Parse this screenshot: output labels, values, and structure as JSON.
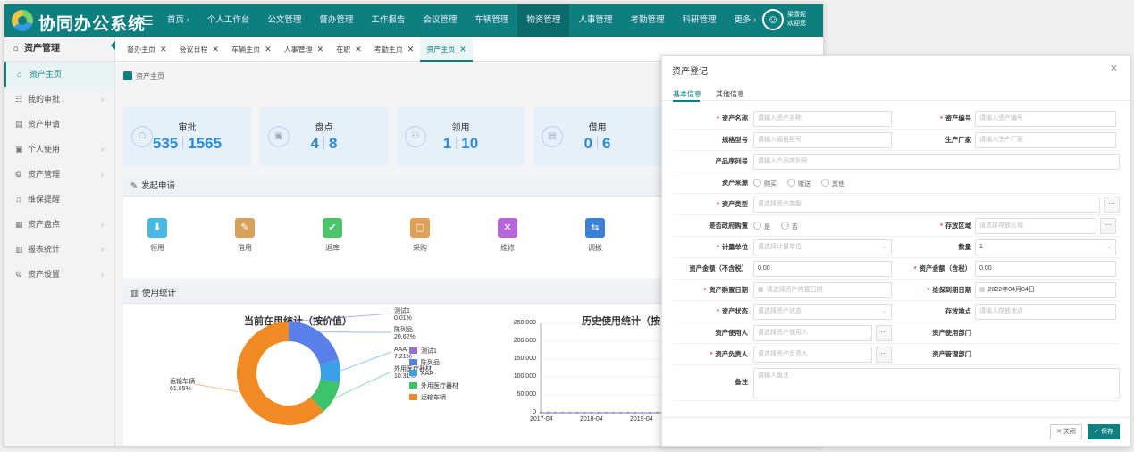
{
  "app": {
    "title": "协同办公系统",
    "user": {
      "name": "梁雪妮",
      "greeting": "欢迎您"
    }
  },
  "nav": {
    "items": [
      "首页 ›",
      "个人工作台",
      "公文管理",
      "督办管理",
      "工作报告",
      "会议管理",
      "车辆管理",
      "物资管理",
      "人事管理",
      "考勤管理",
      "科研管理",
      "更多 ›"
    ],
    "active_index": 7
  },
  "sidebar": {
    "header": "资产管理",
    "items": [
      {
        "label": "资产主页",
        "icon": "home-icon",
        "glyph": "⌂",
        "chevron": false,
        "active": true
      },
      {
        "label": "我的审批",
        "icon": "approval-icon",
        "glyph": "☷",
        "chevron": true
      },
      {
        "label": "资产申请",
        "icon": "apply-icon",
        "glyph": "▤",
        "chevron": false
      },
      {
        "label": "个人使用",
        "icon": "personal-icon",
        "glyph": "▣",
        "chevron": true
      },
      {
        "label": "资产管理",
        "icon": "manage-icon",
        "glyph": "❂",
        "chevron": true
      },
      {
        "label": "维保提醒",
        "icon": "bell-icon",
        "glyph": "♫",
        "chevron": false
      },
      {
        "label": "资产盘点",
        "icon": "inventory-icon",
        "glyph": "▦",
        "chevron": true
      },
      {
        "label": "报表统计",
        "icon": "report-icon",
        "glyph": "▥",
        "chevron": true
      },
      {
        "label": "资产设置",
        "icon": "settings-icon",
        "glyph": "⚙",
        "chevron": true
      }
    ]
  },
  "tabs": [
    {
      "label": "督办主页"
    },
    {
      "label": "会议日程"
    },
    {
      "label": "车辆主页"
    },
    {
      "label": "人事管理"
    },
    {
      "label": "在职"
    },
    {
      "label": "考勤主页"
    },
    {
      "label": "资产主页",
      "active": true
    }
  ],
  "breadcrumb": "资产主页",
  "stats": [
    {
      "label": "审批",
      "a": "535",
      "b": "1565",
      "icon": "approval-stat-icon",
      "glyph": "☖"
    },
    {
      "label": "盘点",
      "a": "4",
      "b": "8",
      "icon": "inventory-stat-icon",
      "glyph": "▣"
    },
    {
      "label": "领用",
      "a": "1",
      "b": "10",
      "icon": "receive-stat-icon",
      "glyph": "⚇"
    },
    {
      "label": "借用",
      "a": "0",
      "b": "6",
      "icon": "borrow-stat-icon",
      "glyph": "▤"
    }
  ],
  "quick": {
    "title": "发起申请",
    "items": [
      {
        "label": "领用",
        "color": "#4ab8e0",
        "icon": "receive-icon",
        "glyph": "⬇"
      },
      {
        "label": "借用",
        "color": "#d9a05b",
        "icon": "borrow-icon",
        "glyph": "✎"
      },
      {
        "label": "退库",
        "color": "#4cc46a",
        "icon": "return-icon",
        "glyph": "✔"
      },
      {
        "label": "采购",
        "color": "#e0a05a",
        "icon": "cart-icon",
        "glyph": "▢"
      },
      {
        "label": "维修",
        "color": "#b567d9",
        "icon": "tools-icon",
        "glyph": "✕"
      },
      {
        "label": "调拨",
        "color": "#3a7fd8",
        "icon": "transfer-icon",
        "glyph": "⇆"
      }
    ]
  },
  "usage": {
    "title": "使用统计"
  },
  "chart_data": [
    {
      "type": "pie",
      "title": "当前在用统计（按价值）",
      "slices": [
        {
          "name": "测试1",
          "value": 0.01,
          "label": "测试1",
          "pct": "0.01%",
          "color": "#9a6fd8"
        },
        {
          "name": "陈列品",
          "value": 20.62,
          "label": "陈列品",
          "pct": "20.62%",
          "color": "#5b7fe8"
        },
        {
          "name": "AAA",
          "value": 7.21,
          "label": "AAA",
          "pct": "7.21%",
          "color": "#3a9ee8"
        },
        {
          "name": "外用医疗器材",
          "value": 10.31,
          "label": "外用医疗器材",
          "pct": "10.31%",
          "color": "#3dc46a"
        },
        {
          "name": "运输车辆",
          "value": 61.85,
          "label": "运输车辆",
          "pct": "61.85%",
          "color": "#f08a24"
        }
      ],
      "legend": [
        "测试1",
        "陈列品",
        "AAA",
        "外用医疗器材",
        "运输车辆"
      ]
    },
    {
      "type": "line",
      "title": "历史使用统计（按",
      "x": [
        "2017-04",
        "2018-04",
        "2019-04"
      ],
      "ylim": [
        0,
        250000
      ],
      "yticks": [
        "250,000",
        "200,000",
        "150,000",
        "100,000",
        "50,000",
        "0"
      ],
      "series": [
        {
          "values": [
            0,
            0,
            0,
            0,
            0,
            0,
            0,
            0,
            0,
            0,
            0,
            0,
            0,
            0,
            0,
            0,
            0,
            0,
            0,
            0,
            0,
            0,
            0,
            0,
            0,
            0,
            0,
            0,
            0,
            0,
            0,
            0,
            6000,
            6000,
            6000,
            6000,
            6000,
            6000,
            6000,
            6000
          ]
        }
      ],
      "color": "#9a8ee0"
    }
  ],
  "dialog": {
    "title": "资产登记",
    "tabs": [
      "基本信息",
      "其他信息"
    ],
    "rows": [
      [
        {
          "label": "资产名称",
          "req": true,
          "placeholder": "请输入资产名称"
        },
        {
          "label": "资产编号",
          "req": true,
          "placeholder": "请输入资产编号"
        }
      ],
      [
        {
          "label": "规格型号",
          "placeholder": "请输入规格型号"
        },
        {
          "label": "生产厂家",
          "placeholder": "请输入生产厂家"
        }
      ],
      [
        {
          "label": "产品序列号",
          "placeholder": "请输入产品序列号",
          "full": true
        }
      ],
      [
        {
          "label": "资产来源",
          "radios": [
            "购买",
            "赠送",
            "其他"
          ]
        }
      ],
      [
        {
          "label": "资产类型",
          "req": true,
          "placeholder": "请选择资产类型",
          "full": true,
          "dots": true
        }
      ],
      [
        {
          "label": "是否政府购置",
          "radios": [
            "是",
            "否"
          ]
        },
        {
          "label": "存放区域",
          "req": true,
          "placeholder": "请选择存放区域",
          "dots": true
        }
      ],
      [
        {
          "label": "计量单位",
          "req": true,
          "placeholder": "请选择计量单位",
          "dd": true
        },
        {
          "label": "数量",
          "value": "1",
          "dd": true
        }
      ],
      [
        {
          "label": "资产金额（不含税）",
          "value": "0.00"
        },
        {
          "label": "资产金额（含税）",
          "req": true,
          "value": "0.00"
        }
      ],
      [
        {
          "label": "资产购置日期",
          "req": true,
          "placeholder": "请选择资产购置日期",
          "cal": true
        },
        {
          "label": "维保到期日期",
          "req": true,
          "value": "2022年04月04日",
          "cal": true
        }
      ],
      [
        {
          "label": "资产状态",
          "req": true,
          "placeholder": "请选择资产状态",
          "dd": true
        },
        {
          "label": "存放地点",
          "placeholder": "请输入存放地点"
        }
      ],
      [
        {
          "label": "资产使用人",
          "placeholder": "请选择资产使用人",
          "dots": true
        },
        {
          "label": "资产使用部门"
        }
      ],
      [
        {
          "label": "资产负责人",
          "req": true,
          "placeholder": "请选择资产负责人",
          "dots": true
        },
        {
          "label": "资产管理部门"
        }
      ]
    ],
    "remark": {
      "label": "备注",
      "placeholder": "请输入备注"
    },
    "buttons": {
      "close": "✕ 关闭",
      "save": "✓ 保存"
    }
  }
}
